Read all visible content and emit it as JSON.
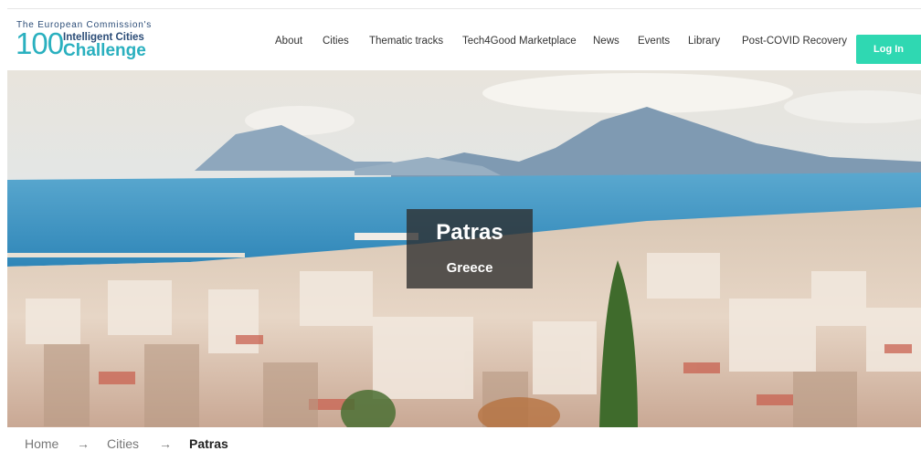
{
  "logo": {
    "line1": "The European Commission's",
    "number": "100",
    "line2": "Intelligent Cities",
    "line3": "Challenge"
  },
  "nav": {
    "items": [
      "About",
      "Cities",
      "Thematic tracks",
      "Tech4Good Marketplace",
      "News",
      "Events",
      "Library",
      "Post-COVID Recovery"
    ],
    "login_label": "Log In"
  },
  "hero": {
    "city": "Patras",
    "country": "Greece"
  },
  "breadcrumb": {
    "home": "Home",
    "sep": "→",
    "cities": "Cities",
    "current": "Patras"
  },
  "colors": {
    "accent": "#2fd8b2",
    "logo_blue": "#2b4c77",
    "logo_teal": "#2ab0bf"
  }
}
